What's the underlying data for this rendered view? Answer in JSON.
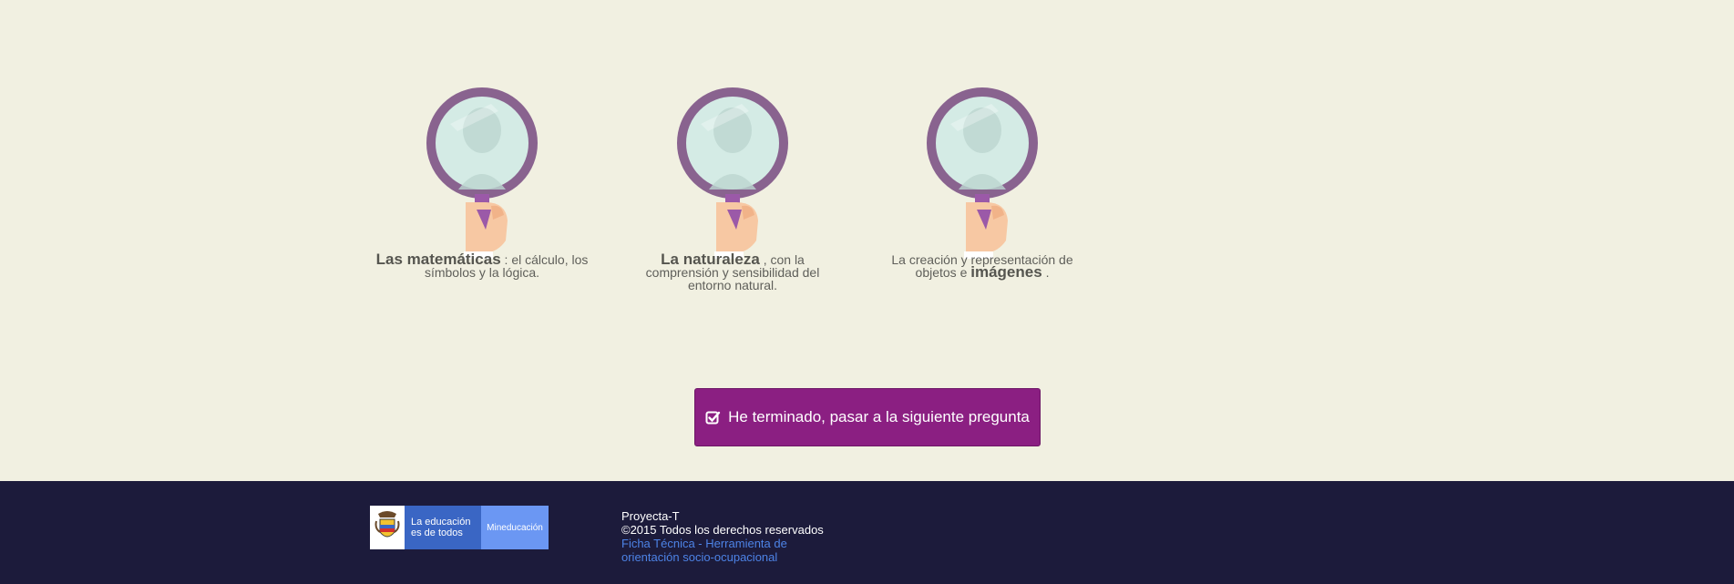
{
  "options": [
    {
      "bold": "Las matemáticas",
      "rest": " : el cálculo, los símbolos y la lógica."
    },
    {
      "bold": "La naturaleza",
      "rest": " , con la comprensión y sensibilidad del entorno natural."
    },
    {
      "pre": "La creación y representación de objetos e ",
      "bold": "imágenes",
      "rest": " ."
    }
  ],
  "next_button": {
    "label": "He terminado, pasar a la siguiente pregunta",
    "icon": "checkbox-checked-icon"
  },
  "footer": {
    "logo_edu_line1": "La educación",
    "logo_edu_line2": "es de todos",
    "logo_ministry": "Mineducación",
    "brand": "Proyecta-T",
    "copyright": "©2015 Todos los derechos reservados",
    "link_text": "Ficha Técnica - Herramienta de orientación socio-ocupacional"
  },
  "colors": {
    "background": "#f1f0e1",
    "accent": "#8b1f82",
    "footer": "#1c1b3b",
    "magnifier_frame": "#89638f",
    "link": "#4d83e6"
  }
}
